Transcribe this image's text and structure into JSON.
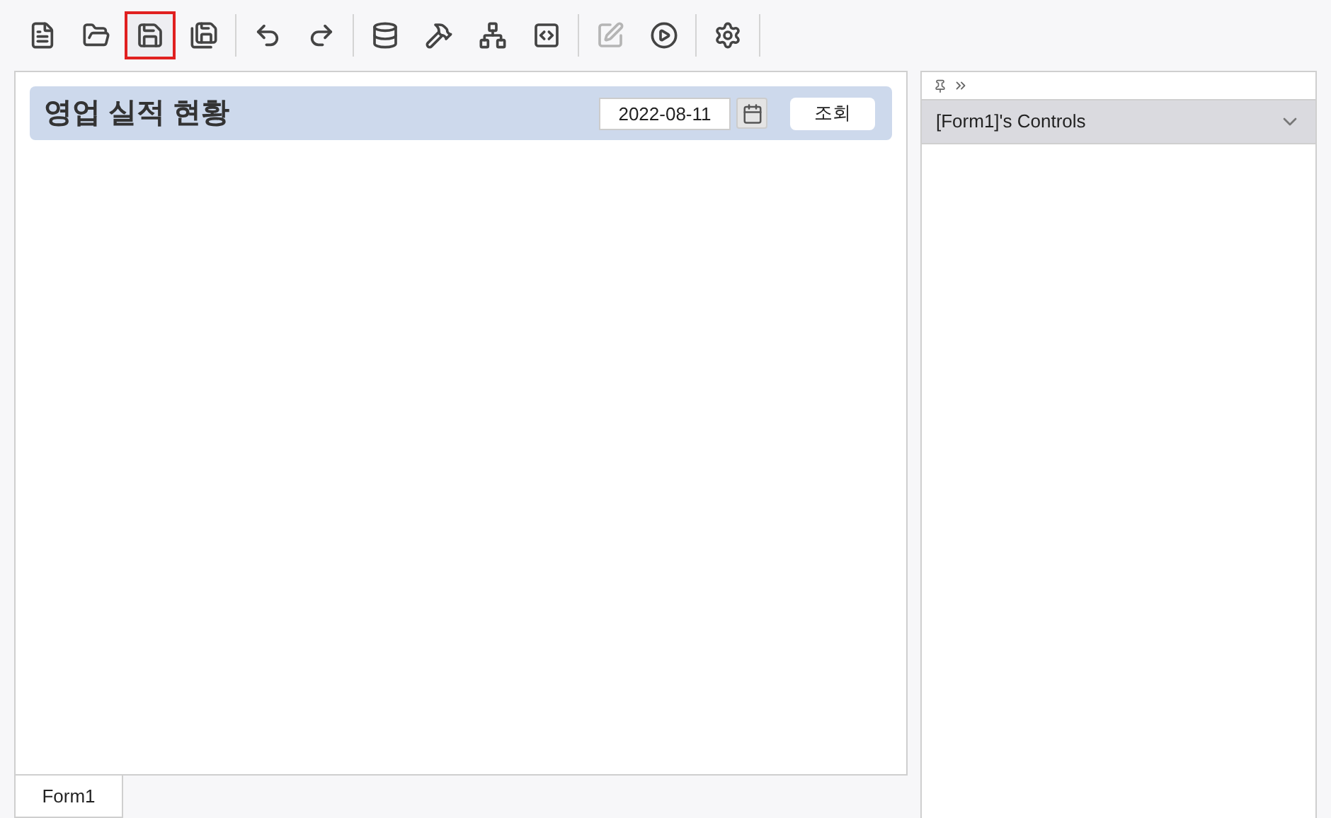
{
  "toolbar": [
    [
      {
        "kind": "new",
        "selected": false,
        "disabled": false
      },
      {
        "kind": "open",
        "selected": false,
        "disabled": false
      },
      {
        "kind": "save",
        "selected": true,
        "disabled": false
      },
      {
        "kind": "save-all",
        "selected": false,
        "disabled": false
      }
    ],
    [
      {
        "kind": "undo",
        "selected": false,
        "disabled": false
      },
      {
        "kind": "redo",
        "selected": false,
        "disabled": false
      }
    ],
    [
      {
        "kind": "database",
        "selected": false,
        "disabled": false
      },
      {
        "kind": "tools",
        "selected": false,
        "disabled": false
      },
      {
        "kind": "hierarchy",
        "selected": false,
        "disabled": false
      },
      {
        "kind": "code",
        "selected": false,
        "disabled": false
      }
    ],
    [
      {
        "kind": "edit",
        "selected": false,
        "disabled": true
      },
      {
        "kind": "run",
        "selected": false,
        "disabled": false
      }
    ],
    [
      {
        "kind": "settings",
        "selected": false,
        "disabled": false
      }
    ]
  ],
  "form": {
    "title": "영업 실적 현황",
    "date": "2022-08-11",
    "search_button": "조회"
  },
  "form_tabs": [
    {
      "label": "Form1",
      "selected": true
    }
  ],
  "controls_panel": {
    "header": "[Form1]'s Controls",
    "expanded": false
  }
}
